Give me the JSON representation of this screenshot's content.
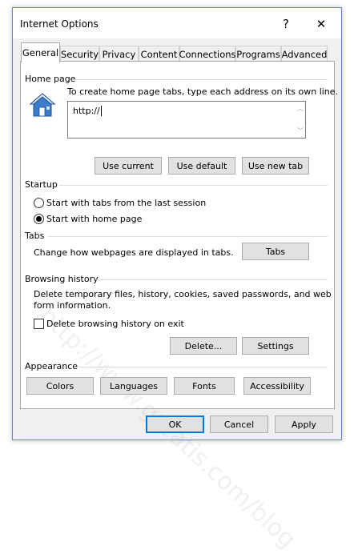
{
  "window": {
    "title": "Internet Options"
  },
  "titlebar": {
    "help": "?",
    "close": "✕"
  },
  "tabs": [
    "General",
    "Security",
    "Privacy",
    "Content",
    "Connections",
    "Programs",
    "Advanced"
  ],
  "home_page": {
    "title": "Home page",
    "description": "To create home page tabs, type each address on its own line.",
    "value": "http://",
    "buttons": {
      "use_current": "Use current",
      "use_default": "Use default",
      "use_new_tab": "Use new tab"
    }
  },
  "startup": {
    "title": "Startup",
    "options": [
      "Start with tabs from the last session",
      "Start with home page"
    ],
    "selected": 1
  },
  "tabs_group": {
    "title": "Tabs",
    "description": "Change how webpages are displayed in tabs.",
    "button": "Tabs"
  },
  "browsing_history": {
    "title": "Browsing history",
    "description_line1": "Delete temporary files, history, cookies, saved passwords, and web",
    "description_line2": "form information.",
    "checkbox_label": "Delete browsing history on exit",
    "checkbox_checked": false,
    "delete_button": "Delete...",
    "settings_button": "Settings"
  },
  "appearance": {
    "title": "Appearance",
    "buttons": [
      "Colors",
      "Languages",
      "Fonts",
      "Accessibility"
    ]
  },
  "footer": {
    "ok": "OK",
    "cancel": "Cancel",
    "apply": "Apply"
  },
  "watermark": "http://www.greatis.com/blog",
  "colors": {
    "window_border": "#6f7fce",
    "default_button_border": "#0078d7",
    "house_icon": "#3a7cc9"
  }
}
